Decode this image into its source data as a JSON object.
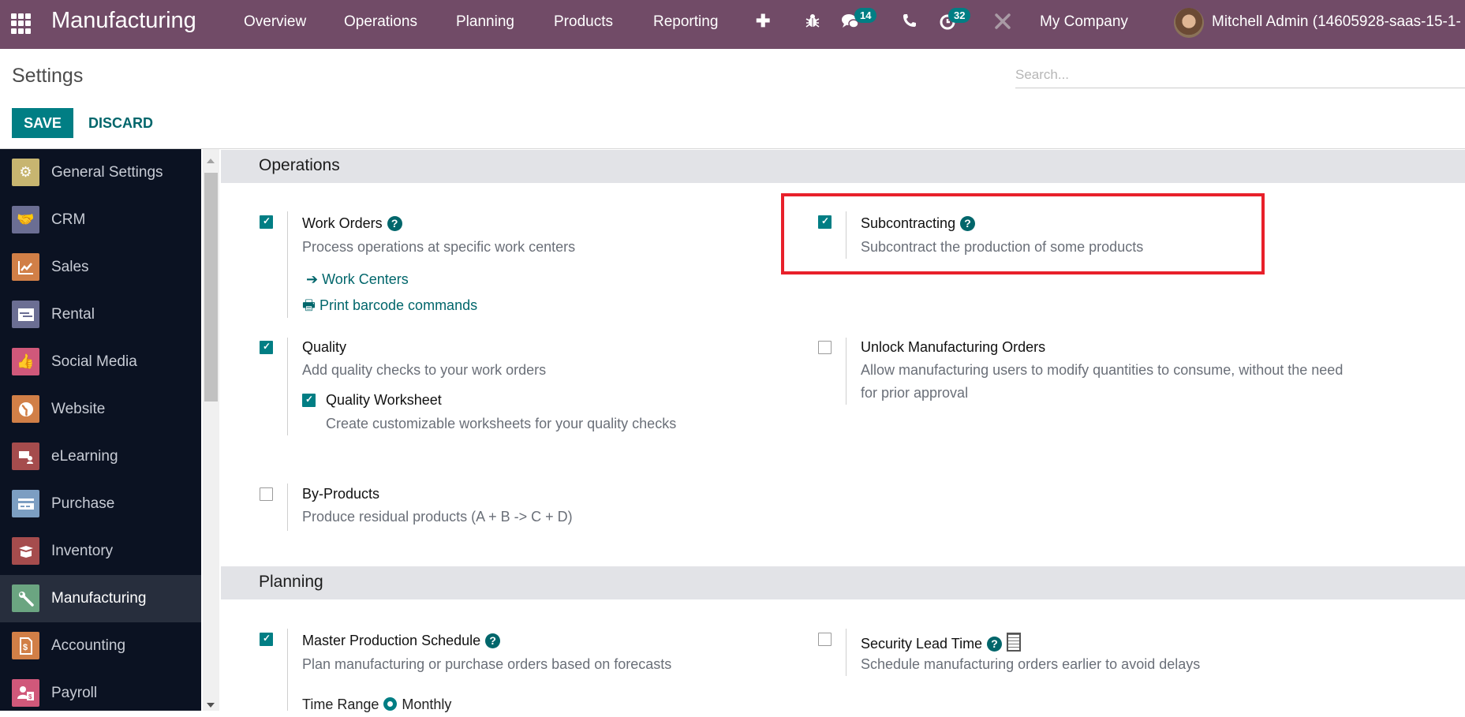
{
  "topbar": {
    "app_name": "Manufacturing",
    "nav": [
      "Overview",
      "Operations",
      "Planning",
      "Products",
      "Reporting"
    ],
    "icons": {
      "apps": "apps-grid-icon",
      "quick_create": "plus-icon",
      "debug": "bug-icon",
      "messages": "chat-icon",
      "phone": "phone-icon",
      "activities": "clock-icon",
      "tools": "tools-icon"
    },
    "messages_count": "14",
    "activities_count": "32",
    "company": "My Company",
    "user": "Mitchell Admin (14605928-saas-15-1-"
  },
  "page": {
    "title": "Settings",
    "search_placeholder": "Search...",
    "save_label": "SAVE",
    "discard_label": "DISCARD"
  },
  "sidebar": {
    "items": [
      {
        "label": "General Settings",
        "icon": "gear-icon",
        "color": "#C7B570",
        "active": false
      },
      {
        "label": "CRM",
        "icon": "handshake-icon",
        "color": "#6B6E93",
        "active": false
      },
      {
        "label": "Sales",
        "icon": "chart-line-icon",
        "color": "#D17F47",
        "active": false
      },
      {
        "label": "Rental",
        "icon": "calendar-table-icon",
        "color": "#6B6E93",
        "active": false
      },
      {
        "label": "Social Media",
        "icon": "thumbs-up-icon",
        "color": "#D0587A",
        "active": false
      },
      {
        "label": "Website",
        "icon": "globe-icon",
        "color": "#D17F47",
        "active": false
      },
      {
        "label": "eLearning",
        "icon": "presentation-icon",
        "color": "#A54C4D",
        "active": false
      },
      {
        "label": "Purchase",
        "icon": "credit-card-icon",
        "color": "#7C9EC2",
        "active": false
      },
      {
        "label": "Inventory",
        "icon": "box-icon",
        "color": "#A54C4D",
        "active": false
      },
      {
        "label": "Manufacturing",
        "icon": "wrench-icon",
        "color": "#6BA581",
        "active": true
      },
      {
        "label": "Accounting",
        "icon": "invoice-icon",
        "color": "#D17F47",
        "active": false
      },
      {
        "label": "Payroll",
        "icon": "payroll-icon",
        "color": "#D0587A",
        "active": false
      }
    ]
  },
  "sections": {
    "operations": {
      "title": "Operations",
      "work_orders": {
        "title": "Work Orders",
        "desc": "Process operations at specific work centers",
        "checked": true,
        "link_work_centers": "Work Centers",
        "link_print_barcode": "Print barcode commands"
      },
      "subcontracting": {
        "title": "Subcontracting",
        "desc": "Subcontract the production of some products",
        "checked": true
      },
      "quality": {
        "title": "Quality",
        "desc": "Add quality checks to your work orders",
        "checked": true,
        "worksheet_title": "Quality Worksheet",
        "worksheet_desc": "Create customizable worksheets for your quality checks",
        "worksheet_checked": true
      },
      "unlock_mo": {
        "title": "Unlock Manufacturing Orders",
        "desc": "Allow manufacturing users to modify quantities to consume, without the need for prior approval",
        "checked": false
      },
      "by_products": {
        "title": "By-Products",
        "desc": "Produce residual products (A + B -> C + D)",
        "checked": false
      }
    },
    "planning": {
      "title": "Planning",
      "mps": {
        "title": "Master Production Schedule",
        "desc": "Plan manufacturing or purchase orders based on forecasts",
        "checked": true,
        "time_range_label": "Time Range",
        "time_range_value": "Monthly"
      },
      "security_lead_time": {
        "title": "Security Lead Time",
        "desc": "Schedule manufacturing orders earlier to avoid delays",
        "checked": false
      }
    }
  },
  "highlight": {
    "color": "#E8202A",
    "target": "Subcontracting"
  }
}
